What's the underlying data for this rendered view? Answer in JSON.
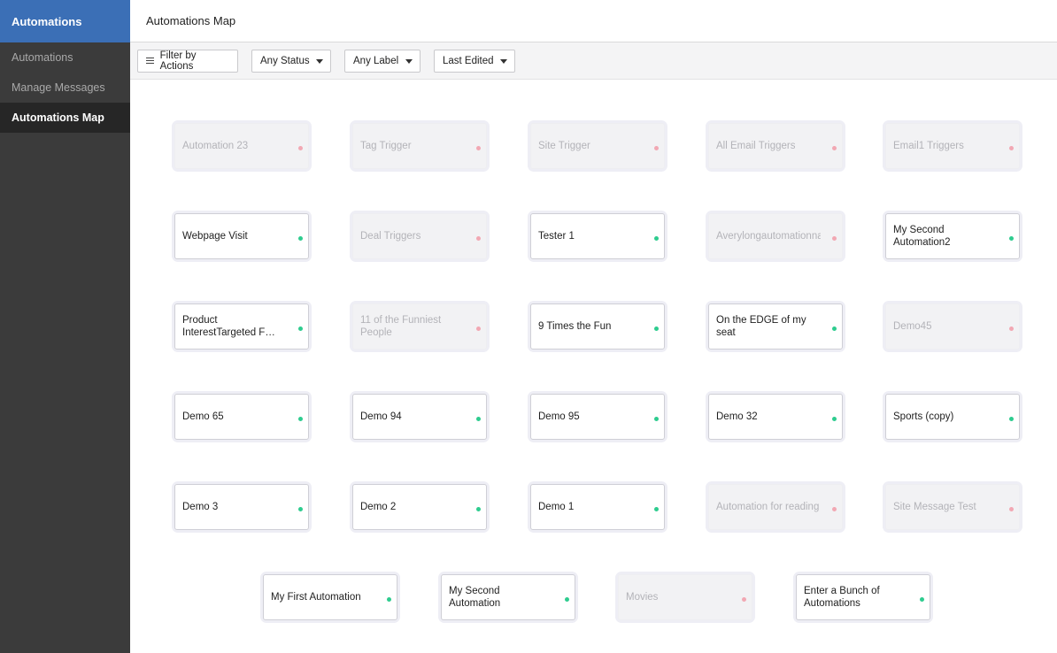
{
  "sidebar": {
    "header": "Automations",
    "items": [
      {
        "label": "Automations",
        "active": false
      },
      {
        "label": "Manage Messages",
        "active": false
      },
      {
        "label": "Automations Map",
        "active": true
      }
    ]
  },
  "header": {
    "title": "Automations Map"
  },
  "filters": {
    "actions": "Filter by Actions",
    "status": "Any Status",
    "label": "Any Label",
    "sort": "Last Edited"
  },
  "colors": {
    "active_dot": "#2ecc8f",
    "inactive_dot": "#f2a8b3"
  },
  "automations": [
    {
      "name": "Automation 23",
      "active": false
    },
    {
      "name": "Tag Trigger",
      "active": false
    },
    {
      "name": "Site Trigger",
      "active": false
    },
    {
      "name": "All Email Triggers",
      "active": false
    },
    {
      "name": "Email1 Triggers",
      "active": false
    },
    {
      "name": "Webpage Visit",
      "active": true
    },
    {
      "name": "Deal Triggers",
      "active": false
    },
    {
      "name": "Tester 1",
      "active": true
    },
    {
      "name": "Averylongautomationnametodosome…",
      "active": false
    },
    {
      "name": "My Second Automation2",
      "active": true
    },
    {
      "name": "Product InterestTargeted F…",
      "active": true
    },
    {
      "name": "11 of the Funniest People",
      "active": false
    },
    {
      "name": "9 Times the Fun",
      "active": true
    },
    {
      "name": "On the EDGE of my seat",
      "active": true
    },
    {
      "name": "Demo45",
      "active": false
    },
    {
      "name": "Demo 65",
      "active": true
    },
    {
      "name": "Demo 94",
      "active": true
    },
    {
      "name": "Demo 95",
      "active": true
    },
    {
      "name": "Demo 32",
      "active": true
    },
    {
      "name": "Sports (copy)",
      "active": true
    },
    {
      "name": "Demo 3",
      "active": true
    },
    {
      "name": "Demo 2",
      "active": true
    },
    {
      "name": "Demo 1",
      "active": true
    },
    {
      "name": "Automation for reading",
      "active": false
    },
    {
      "name": "Site Message Test",
      "active": false
    },
    {
      "name": "My First Automation",
      "active": true
    },
    {
      "name": "My Second Automation",
      "active": true
    },
    {
      "name": "Movies",
      "active": false
    },
    {
      "name": "Enter a Bunch of Automations",
      "active": true
    }
  ]
}
